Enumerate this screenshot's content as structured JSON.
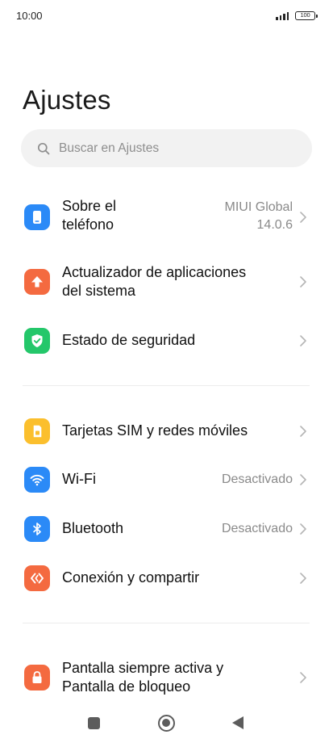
{
  "status_bar": {
    "time": "10:00",
    "battery_level": "100",
    "signal_strength_bars": 4
  },
  "page": {
    "title": "Ajustes"
  },
  "search": {
    "placeholder": "Buscar en Ajustes",
    "icon": "search-icon"
  },
  "colors": {
    "phone_blue": "#2b8af7",
    "update_orange": "#f46a40",
    "security_green": "#24c76a",
    "sim_yellow": "#fbbf2d",
    "wifi_blue": "#2b8af7",
    "bluetooth_blue": "#2b8af7",
    "share_orange": "#f46a40",
    "lock_orange": "#f46a40"
  },
  "settings": {
    "about": {
      "label_line1": "Sobre el",
      "label_line2": "teléfono",
      "value_line1": "MIUI Global",
      "value_line2": "14.0.6",
      "icon": "phone-icon"
    },
    "system_updater": {
      "label_line1": "Actualizador de aplicaciones",
      "label_line2": "del sistema",
      "icon": "update-arrow-icon"
    },
    "security": {
      "label": "Estado de seguridad",
      "icon": "shield-check-icon"
    },
    "sim": {
      "label": "Tarjetas SIM y redes móviles",
      "icon": "sim-card-icon"
    },
    "wifi": {
      "label": "Wi-Fi",
      "value": "Desactivado",
      "icon": "wifi-icon"
    },
    "bluetooth": {
      "label": "Bluetooth",
      "value": "Desactivado",
      "icon": "bluetooth-icon"
    },
    "connection": {
      "label": "Conexión y compartir",
      "icon": "connection-share-icon"
    },
    "lock_screen": {
      "label_line1": "Pantalla siempre activa y",
      "label_line2": "Pantalla de bloqueo",
      "icon": "lock-icon"
    }
  },
  "nav_bar": {
    "recents": "recents-icon",
    "home": "home-icon",
    "back": "back-icon"
  }
}
